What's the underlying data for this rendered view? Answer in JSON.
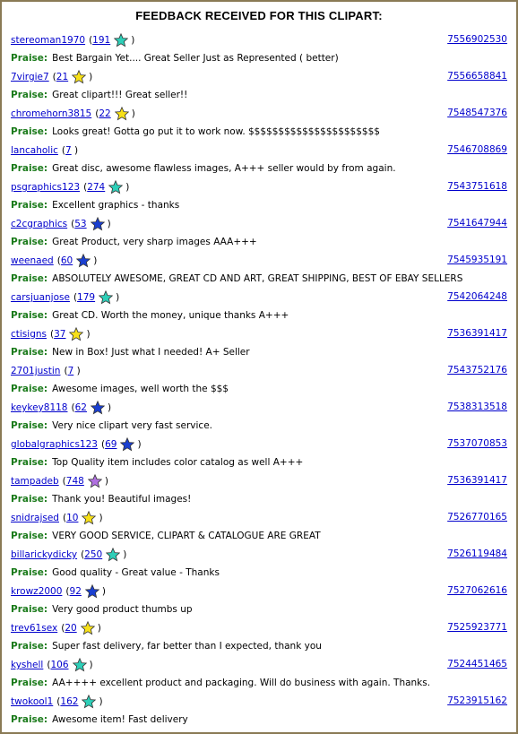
{
  "title": "FEEDBACK RECEIVED FOR THIS CLIPART:",
  "praise_label": "Praise:",
  "star_colors": {
    "teal": "#2ecfb8",
    "yellow": "#f7e018",
    "blue": "#1a3fd0",
    "purple": "#b070e0"
  },
  "entries": [
    {
      "user": "stereoman1970",
      "score": "191",
      "star": "teal",
      "id": "7556902530",
      "comment": "Best Bargain Yet.... Great Seller Just as Represented ( better)"
    },
    {
      "user": "7virgie7",
      "score": "21",
      "star": "yellow",
      "id": "7556658841",
      "comment": "Great clipart!!!  Great seller!!"
    },
    {
      "user": "chromehorn3815",
      "score": "22",
      "star": "yellow",
      "id": "7548547376",
      "comment": "Looks great!  Gotta go put it to work now. $$$$$$$$$$$$$$$$$$$$$$"
    },
    {
      "user": "lancaholic",
      "score": "7",
      "star": "none",
      "id": "7546708869",
      "comment": "Great disc, awesome flawless images, A+++ seller would by from again."
    },
    {
      "user": "psgraphics123",
      "score": "274",
      "star": "teal",
      "id": "7543751618",
      "comment": "Excellent graphics - thanks"
    },
    {
      "user": "c2cgraphics",
      "score": "53",
      "star": "blue",
      "id": "7541647944",
      "comment": "Great Product, very sharp images AAA+++"
    },
    {
      "user": "weenaed",
      "score": "60",
      "star": "blue",
      "id": "7545935191",
      "comment": "ABSOLUTELY AWESOME, GREAT CD AND ART, GREAT SHIPPING, BEST OF EBAY SELLERS"
    },
    {
      "user": "carsjuanjose",
      "score": "179",
      "star": "teal",
      "id": "7542064248",
      "comment": "Great CD.  Worth the money, unique thanks A+++"
    },
    {
      "user": "ctisigns",
      "score": "37",
      "star": "yellow",
      "id": "7536391417",
      "comment": "New in Box!  Just what I needed!  A+ Seller"
    },
    {
      "user": "2701justin",
      "score": "7",
      "star": "none",
      "id": "7543752176",
      "comment": "Awesome images, well worth the $$$"
    },
    {
      "user": "keykey8118",
      "score": "62",
      "star": "blue",
      "id": "7538313518",
      "comment": "Very nice clipart very fast service."
    },
    {
      "user": "globalgraphics123",
      "score": "69",
      "star": "blue",
      "id": "7537070853",
      "comment": "Top Quality item includes color catalog as well A+++"
    },
    {
      "user": "tampadeb",
      "score": "748",
      "star": "purple",
      "id": "7536391417",
      "comment": "Thank you!  Beautiful images!"
    },
    {
      "user": "snidrajsed",
      "score": "10",
      "star": "yellow",
      "id": "7526770165",
      "comment": "VERY GOOD SERVICE, CLIPART & CATALOGUE ARE GREAT"
    },
    {
      "user": "billarickydicky",
      "score": "250",
      "star": "teal",
      "id": "7526119484",
      "comment": "Good quality - Great value - Thanks"
    },
    {
      "user": "krowz2000",
      "score": "92",
      "star": "blue",
      "id": "7527062616",
      "comment": "Very good product thumbs up"
    },
    {
      "user": "trev61sex",
      "score": "20",
      "star": "yellow",
      "id": "7525923771",
      "comment": "Super fast delivery, far better than I expected, thank you"
    },
    {
      "user": "kyshell",
      "score": "106",
      "star": "teal",
      "id": "7524451465",
      "comment": "AA++++ excellent product and packaging.  Will do business with again.  Thanks."
    },
    {
      "user": "twokool1",
      "score": "162",
      "star": "teal",
      "id": "7523915162",
      "comment": "Awesome item!  Fast delivery"
    }
  ]
}
